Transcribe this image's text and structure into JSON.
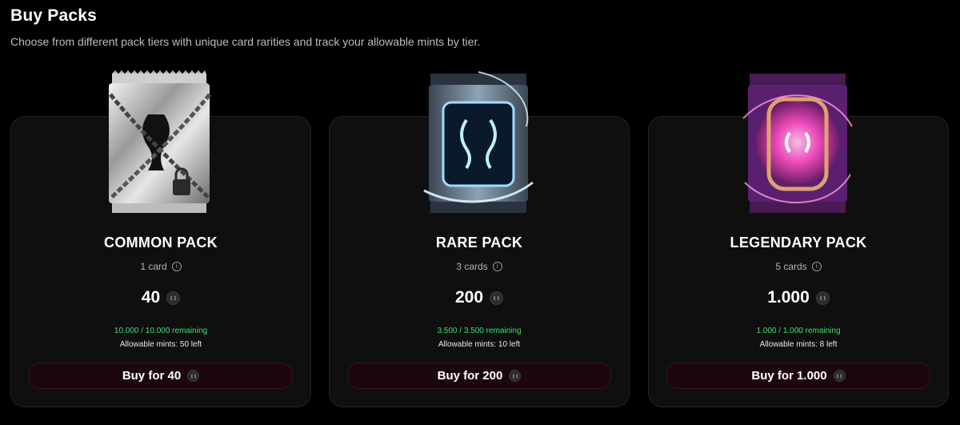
{
  "header": {
    "title": "Buy Packs",
    "subtitle": "Choose from different pack tiers with unique card rarities and track your allowable mints by tier."
  },
  "packs": [
    {
      "name": "COMMON PACK",
      "cards": "1 card",
      "price": "40",
      "remaining": "10.000 / 10.000 remaining",
      "mints": "Allowable mints: 50 left",
      "buy_label": "Buy for 40",
      "theme": "silver-chained"
    },
    {
      "name": "RARE PACK",
      "cards": "3 cards",
      "price": "200",
      "remaining": "3.500 / 3.500 remaining",
      "mints": "Allowable mints: 10 left",
      "buy_label": "Buy for 200",
      "theme": "blue-neon"
    },
    {
      "name": "LEGENDARY PACK",
      "cards": "5 cards",
      "price": "1.000",
      "remaining": "1.000 / 1.000 remaining",
      "mints": "Allowable mints: 8 left",
      "buy_label": "Buy for 1.000",
      "theme": "pink-neon"
    }
  ],
  "icons": {
    "info": "info-icon",
    "currency": "coin-icon"
  },
  "colors": {
    "background": "#000000",
    "card_background": "#0f0f10",
    "remaining_green": "#3ee06a",
    "button_background": "#1c0710",
    "rare_accent": "#6ec6ff",
    "legendary_accent": "#ff3fbf"
  }
}
